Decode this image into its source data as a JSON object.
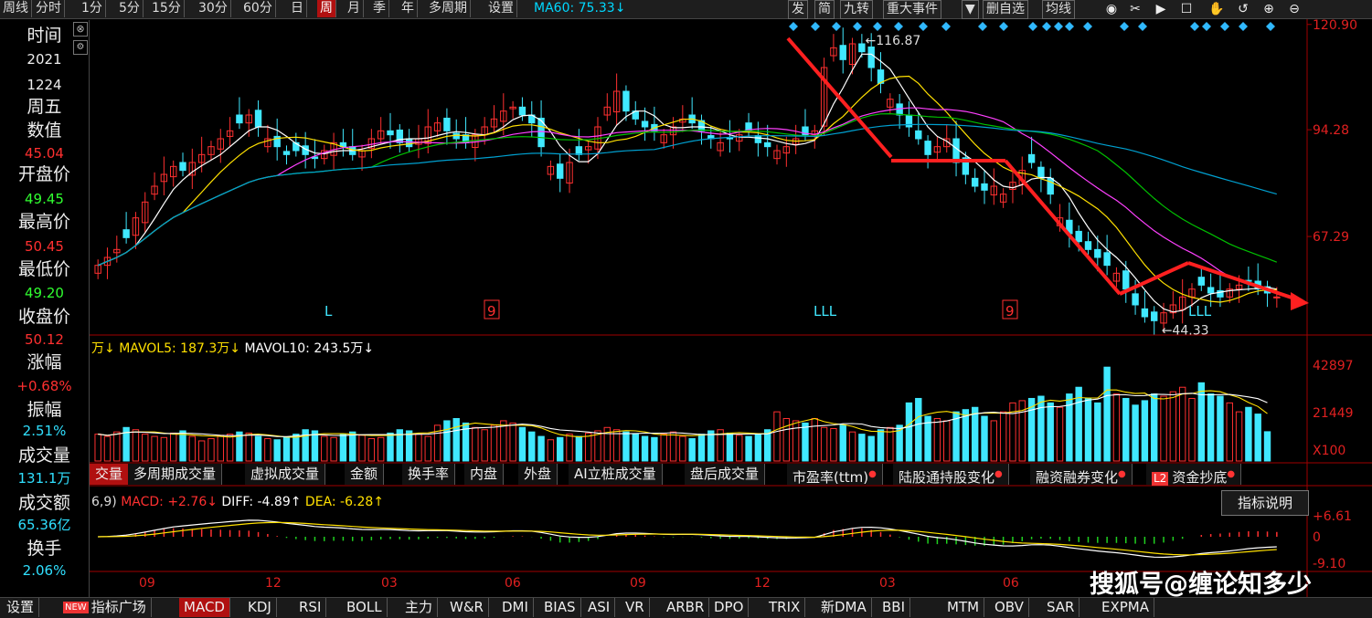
{
  "topbar": {
    "periods": [
      "周线",
      "分时",
      "1分",
      "5分",
      "15分",
      "30分",
      "60分",
      "日",
      "周",
      "月",
      "季",
      "年",
      "多周期",
      "设置"
    ],
    "active_period": "周",
    "ma60_label": "MA60: 75.33↓",
    "right_buttons": [
      "发",
      "简",
      "九转",
      "重大事件",
      "▼",
      "删自选",
      "均线"
    ]
  },
  "info_panel": {
    "items": [
      {
        "label": "时间",
        "value": "2021",
        "color": "#eeeeee"
      },
      {
        "label": "",
        "value": "1224",
        "color": "#eeeeee"
      },
      {
        "label": "周五",
        "value": "",
        "color": "#eeeeee"
      },
      {
        "label": "数值",
        "value": "45.04",
        "color": "#ff3030"
      },
      {
        "label": "开盘价",
        "value": "49.45",
        "color": "#30ff30"
      },
      {
        "label": "最高价",
        "value": "50.45",
        "color": "#ff3030"
      },
      {
        "label": "最低价",
        "value": "49.20",
        "color": "#30ff30"
      },
      {
        "label": "收盘价",
        "value": "50.12",
        "color": "#ff3030"
      },
      {
        "label": "涨幅",
        "value": "+0.68%",
        "color": "#ff3030"
      },
      {
        "label": "振幅",
        "value": "2.51%",
        "color": "#30e0ff"
      },
      {
        "label": "成交量",
        "value": "131.1万",
        "color": "#30e0ff"
      },
      {
        "label": "成交额",
        "value": "65.36亿",
        "color": "#30e0ff"
      },
      {
        "label": "换手",
        "value": "2.06%",
        "color": "#30e0ff"
      }
    ],
    "close_icon": "close-icon",
    "settings_icon": "gear-icon"
  },
  "price_axis": [
    "120.90",
    "94.28",
    "67.29"
  ],
  "volume_axis": [
    "42897",
    "21449",
    "X100"
  ],
  "macd_axis": [
    "+6.61",
    "0",
    "-9.10"
  ],
  "date_ticks": [
    "09",
    "12",
    "03",
    "06",
    "09",
    "12",
    "03",
    "06"
  ],
  "annotations": {
    "high_label": "116.87",
    "low_label": "44.33",
    "markers": [
      "L",
      "LLL",
      "LLL",
      "9",
      "9"
    ]
  },
  "volume_legend": {
    "prefix": "万↓",
    "mavol5": "MAVOL5: 187.3万↓",
    "mavol10": "MAVOL10: 243.5万↓"
  },
  "volume_tabs": [
    {
      "label": "交量",
      "active": true,
      "dot": false
    },
    {
      "label": "多周期成交量",
      "active": false,
      "dot": false
    },
    {
      "label": "虚拟成交量",
      "active": false,
      "dot": false
    },
    {
      "label": "金额",
      "active": false,
      "dot": false
    },
    {
      "label": "换手率",
      "active": false,
      "dot": false
    },
    {
      "label": "内盘",
      "active": false,
      "dot": false
    },
    {
      "label": "外盘",
      "active": false,
      "dot": false
    },
    {
      "label": "AI立桩成交量",
      "active": false,
      "dot": false
    },
    {
      "label": "盘后成交量",
      "active": false,
      "dot": false
    },
    {
      "label": "市盈率(ttm)",
      "active": false,
      "dot": true
    },
    {
      "label": "陆股通持股变化",
      "active": false,
      "dot": true
    },
    {
      "label": "融资融券变化",
      "active": false,
      "dot": true
    },
    {
      "label": "资金抄底",
      "active": false,
      "dot": true,
      "badge": "L2"
    }
  ],
  "macd_legend": {
    "prefix": "6,9)",
    "macd": "MACD: +2.76↓",
    "diff": "DIFF: -4.89↑",
    "dea": "DEA: -6.28↑"
  },
  "indicator_explain": "指标说明",
  "bottom_bar": {
    "settings": "设置",
    "new_badge": "NEW",
    "items": [
      "指标广场",
      "MACD",
      "KDJ",
      "RSI",
      "BOLL",
      "主力",
      "W&R",
      "DMI",
      "BIAS",
      "ASI",
      "VR",
      "ARBR",
      "DPO",
      "TRIX",
      "新DMA",
      "BBI",
      "MTM",
      "OBV",
      "SAR",
      "EXPMA"
    ],
    "active": "MACD"
  },
  "watermark": "搜狐号@缠论知多少",
  "colors": {
    "up": "#ff3030",
    "down": "#40e8ff",
    "ma5": "#ffffff",
    "ma10": "#ffe000",
    "ma20": "#ff40ff",
    "ma30": "#00c000",
    "ma60": "#00a0d0",
    "arrow": "#ff2020"
  },
  "chart_data": {
    "type": "candlestick",
    "period": "weekly",
    "y_ticks": [
      67.29,
      94.28,
      120.9
    ],
    "ylim": [
      44,
      122
    ],
    "high": 116.87,
    "low": 44.33,
    "x_ticks": [
      "09",
      "12",
      "03",
      "06",
      "09",
      "12",
      "03",
      "06"
    ],
    "closes": [
      60,
      62,
      64,
      67,
      72,
      76,
      80,
      83,
      85,
      84,
      86,
      88,
      90,
      92,
      94,
      96,
      98,
      95,
      92,
      90,
      88,
      89,
      88,
      87,
      89,
      91,
      90,
      88,
      89,
      92,
      94,
      93,
      91,
      90,
      92,
      95,
      96,
      94,
      92,
      91,
      93,
      95,
      97,
      99,
      100,
      98,
      96,
      90,
      85,
      82,
      86,
      88,
      90,
      95,
      100,
      104,
      99,
      97,
      95,
      94,
      93,
      95,
      97,
      96,
      94,
      92,
      91,
      92,
      93,
      94,
      91,
      90,
      89,
      90,
      92,
      93,
      94,
      110,
      115,
      112,
      116,
      114,
      110,
      106,
      102,
      98,
      95,
      92,
      88,
      90,
      92,
      86,
      83,
      80,
      79,
      80,
      78,
      81,
      84,
      86,
      82,
      78,
      72,
      68,
      66,
      64,
      62,
      60,
      58,
      54,
      50,
      47,
      46,
      48,
      50,
      52,
      54,
      55,
      53,
      52,
      54,
      55,
      56,
      54,
      53,
      52
    ],
    "volume_max": 42897,
    "volumes": [
      12000,
      11000,
      13000,
      15000,
      14000,
      12000,
      11000,
      10500,
      12500,
      13500,
      11000,
      9000,
      10000,
      11500,
      12000,
      13000,
      12500,
      11000,
      10000,
      9500,
      10500,
      12000,
      14000,
      13500,
      11000,
      10500,
      12000,
      13000,
      11500,
      10000,
      10500,
      12500,
      14000,
      13500,
      12000,
      11000,
      16000,
      18000,
      19000,
      17000,
      15000,
      14000,
      16000,
      18000,
      17000,
      15000,
      13000,
      11000,
      9500,
      10500,
      12000,
      11000,
      12500,
      13500,
      15000,
      14000,
      13000,
      12000,
      11000,
      10500,
      12000,
      13000,
      11000,
      10000,
      12000,
      13500,
      14000,
      12500,
      11500,
      11000,
      12000,
      14000,
      22000,
      19000,
      18000,
      17000,
      19000,
      15000,
      14500,
      16000,
      13000,
      12000,
      11000,
      14000,
      15000,
      16000,
      26000,
      28000,
      20000,
      19000,
      18000,
      22000,
      23000,
      24000,
      20000,
      18000,
      22000,
      26000,
      27000,
      28000,
      29000,
      26000,
      24000,
      30000,
      33000,
      28000,
      26000,
      42000,
      30000,
      28000,
      25000,
      27000,
      30000,
      29000,
      31000,
      33000,
      28000,
      35000,
      30000,
      29000,
      26000,
      22000,
      24000,
      21000,
      13111
    ],
    "macd_diff_range": [
      -9.1,
      6.61
    ],
    "macd": 2.76,
    "diff": -4.89,
    "dea": -6.28
  }
}
